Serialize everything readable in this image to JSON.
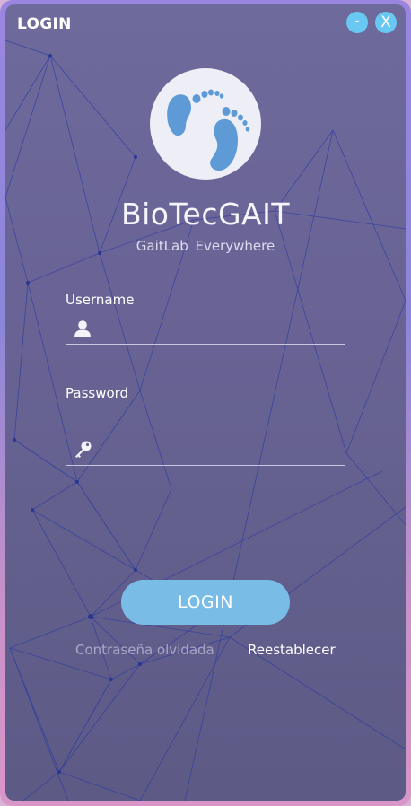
{
  "window": {
    "title": "LOGIN",
    "minimize_label": "-",
    "close_label": "X"
  },
  "brand": {
    "name": "BioTecGAIT",
    "tagline": "GaitLab  Everywhere",
    "logo_icon": "footprints-icon"
  },
  "form": {
    "username": {
      "label": "Username",
      "value": "",
      "placeholder": "",
      "icon": "user-icon"
    },
    "password": {
      "label": "Password",
      "value": "",
      "placeholder": "",
      "icon": "key-icon"
    },
    "login_button": "LOGIN"
  },
  "footer": {
    "forgot_text": "Contraseña olvidada",
    "reset_link": "Reestablecer"
  },
  "colors": {
    "accent": "#79bde6",
    "window_button": "#69c8f2",
    "foot_icon": "#5e9bd6"
  }
}
